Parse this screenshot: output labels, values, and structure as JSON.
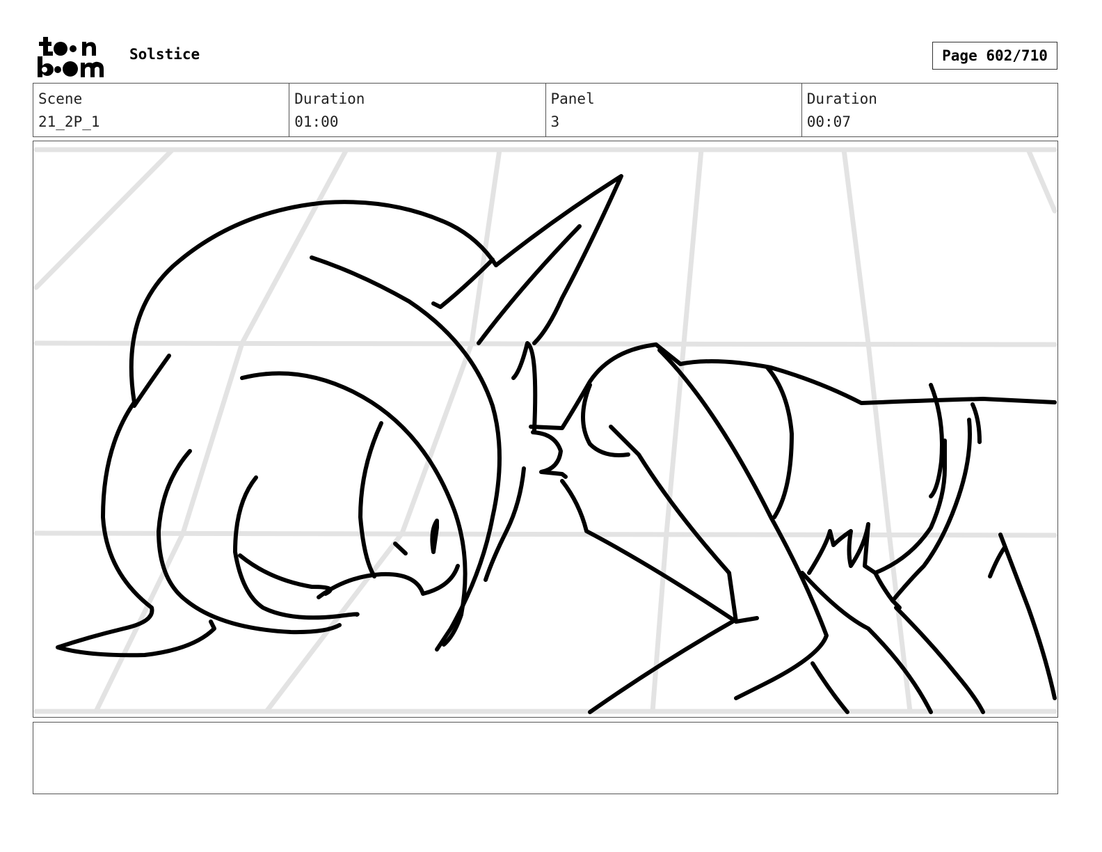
{
  "logo": {
    "text_top": "toon",
    "text_bottom": "boom",
    "icon": "toon-boom-logo"
  },
  "header": {
    "project_title": "Solstice",
    "page_label": "Page 602/710"
  },
  "info": {
    "scene_label": "Scene",
    "scene_value": "21_2P_1",
    "scene_duration_label": "Duration",
    "scene_duration_value": "01:00",
    "panel_label": "Panel",
    "panel_value": "3",
    "panel_duration_label": "Duration",
    "panel_duration_value": "00:07"
  },
  "panel": {
    "image": "storyboard-sketch-character-hugging"
  },
  "notes": {
    "text": ""
  }
}
